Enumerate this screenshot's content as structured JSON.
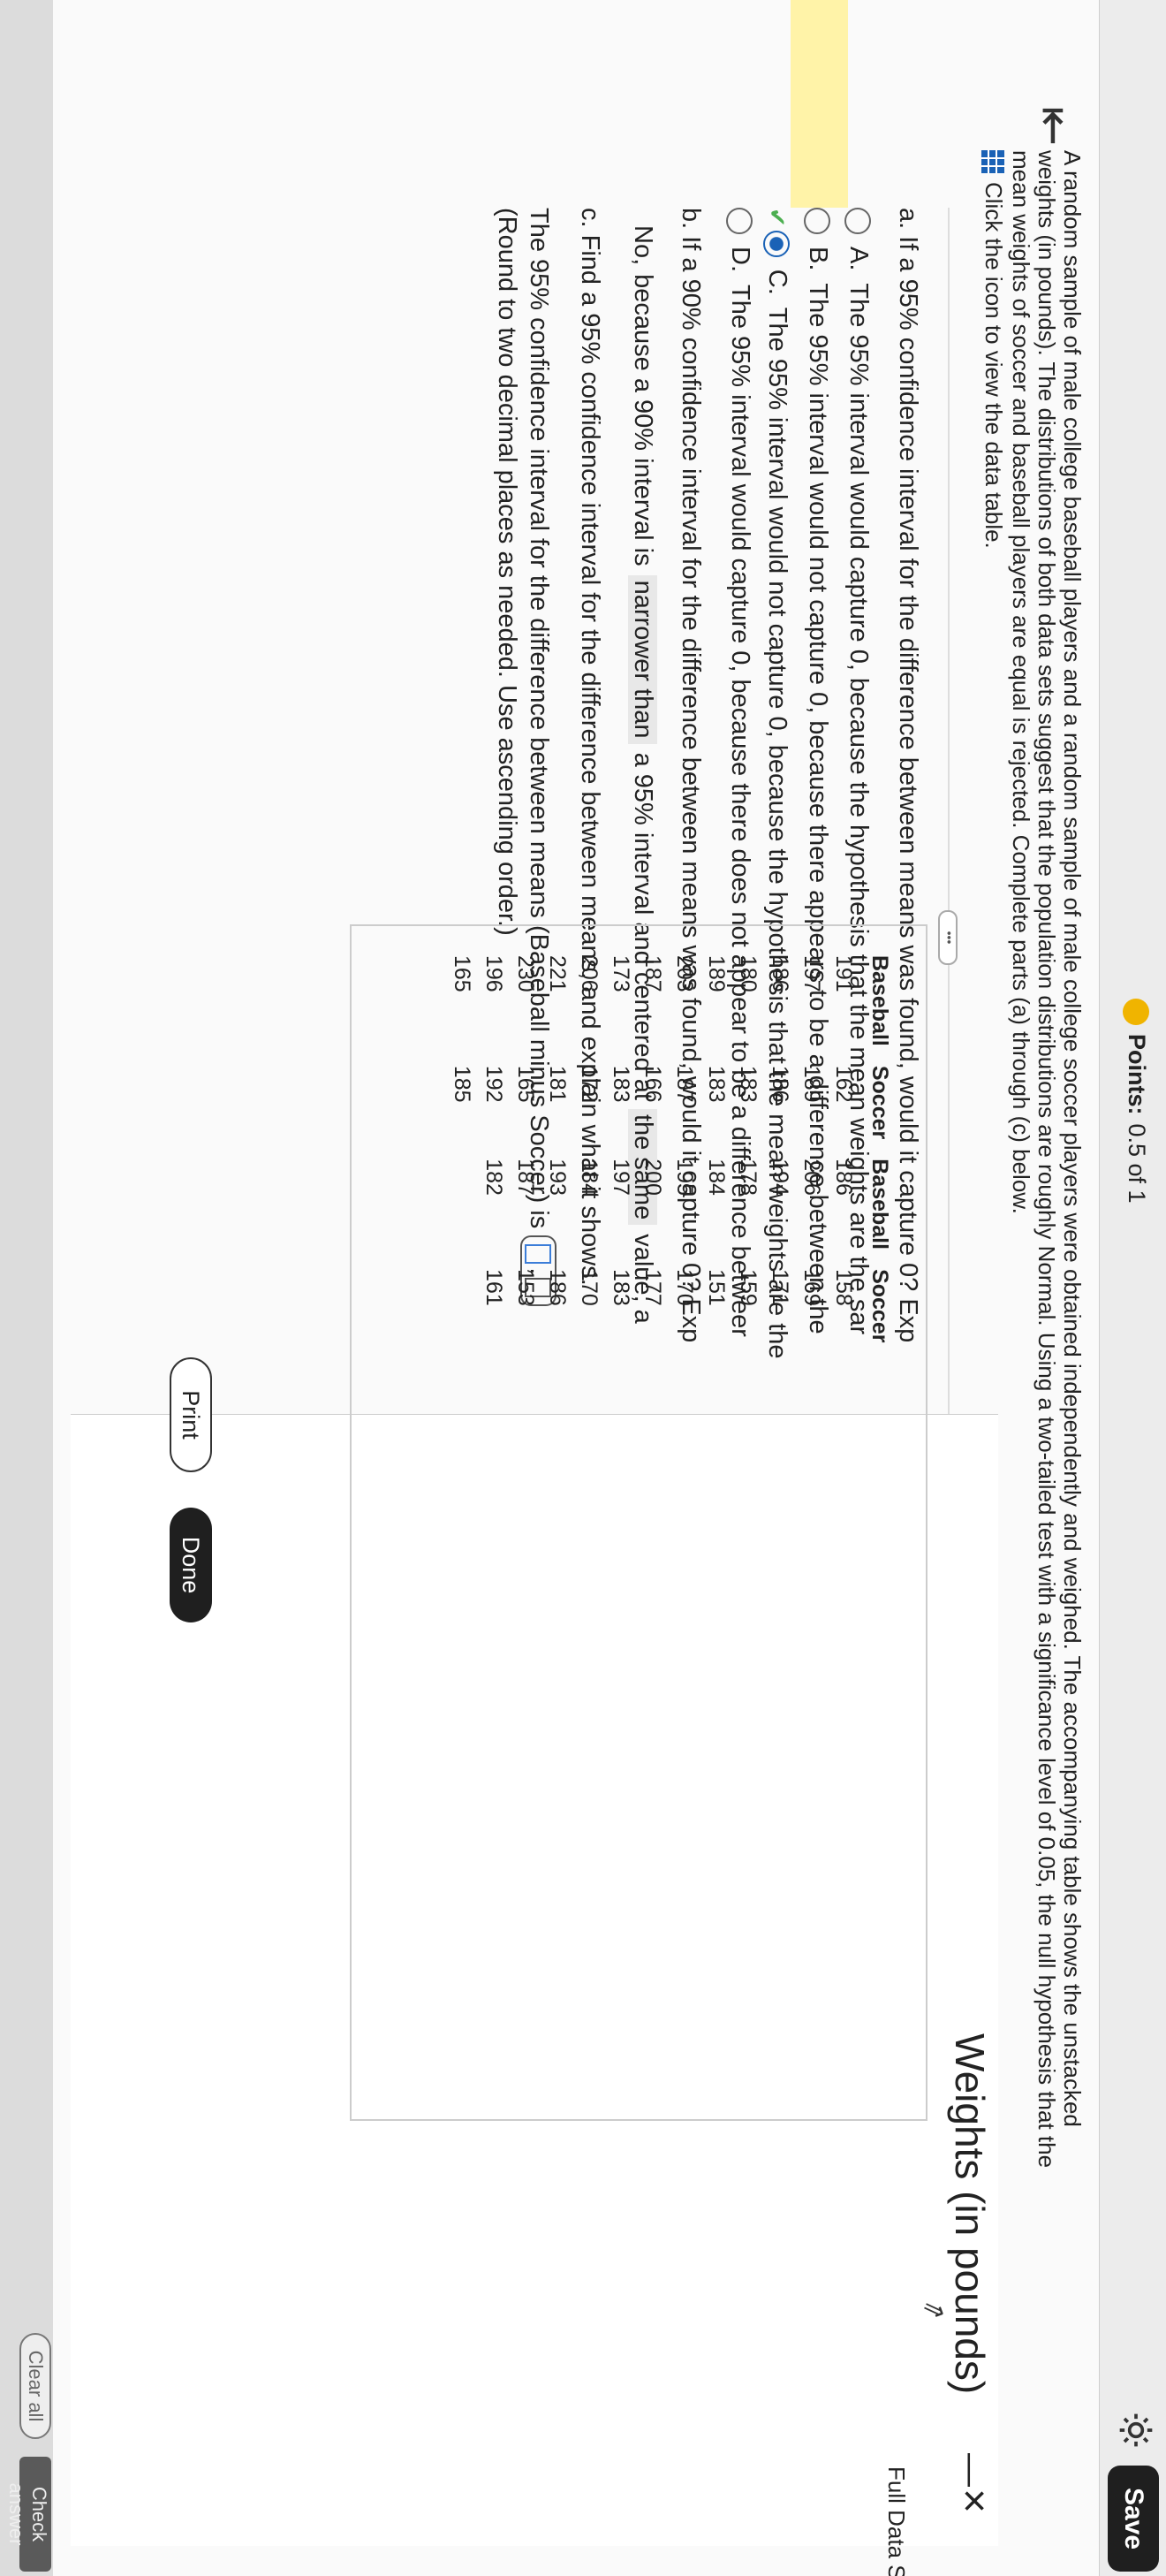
{
  "header": {
    "points_label": "Points:",
    "points_value": "0.5 of 1",
    "save_label": "Save"
  },
  "question": {
    "text_line1": "A random sample of male college baseball players and a random sample of male college soccer players were obtained independently and weighed. The accompanying table shows the unstacked",
    "text_line2": "weights (in pounds). The distributions of both data sets suggest that the population distributions are roughly Normal. Using a two-tailed test with a significance level of 0.05, the null hypothesis that the",
    "text_line3": "mean weights of soccer and baseball players are equal is rejected. Complete parts (a) through (c) below.",
    "data_link": "Click the icon to view the data table."
  },
  "part_a": {
    "question": "a. If a 95% confidence interval for the difference between means was found, would it capture 0? Exp",
    "options": [
      {
        "letter": "A.",
        "text": "The 95% interval would capture 0, because the hypothesis that the mean weights are the sar"
      },
      {
        "letter": "B.",
        "text": "The 95% interval would not capture 0, because there appears to be a difference between the"
      },
      {
        "letter": "C.",
        "text": "The 95% interval would not capture 0, because the hypothesis that the mean weights are the"
      },
      {
        "letter": "D.",
        "text": "The 95% interval would capture 0, because there does not appear to be a difference betweer"
      }
    ]
  },
  "part_b": {
    "question": "b. If a 90% confidence interval for the difference between means was found, would it capture 0? Exp",
    "answer_start": "No,",
    "answer_mid1": "because a 90% interval is",
    "blank1": "narrower than",
    "answer_mid2": "a 95% interval and centered at",
    "blank2": "the same",
    "answer_end": "value, a"
  },
  "part_c": {
    "question": "c. Find a 95% confidence interval for the difference between means, and explain what it shows.",
    "line": "The 95% confidence interval for the difference between means (Baseball minus Soccer) is",
    "separator": ",",
    "note": "(Round to two decimal places as needed. Use ascending order.)"
  },
  "dialog": {
    "title": "Weights (in pounds)",
    "full_data_label": "Full Data Set",
    "headers": [
      "Baseball",
      "Soccer",
      "Baseball",
      "Soccer"
    ],
    "rows": [
      [
        "191",
        "162",
        "186",
        "158"
      ],
      [
        "197",
        "189",
        "206",
        "169"
      ],
      [
        "186",
        "186",
        "194",
        "171"
      ],
      [
        "180",
        "183",
        "178",
        "159"
      ],
      [
        "189",
        "183",
        "184",
        "151"
      ],
      [
        "203",
        "187",
        "195",
        "170"
      ],
      [
        "187",
        "166",
        "200",
        "177"
      ],
      [
        "173",
        "183",
        "197",
        "183"
      ],
      [
        "206",
        "172",
        "184",
        "170"
      ],
      [
        "221",
        "181",
        "193",
        "186"
      ],
      [
        "230",
        "165",
        "187",
        "153"
      ],
      [
        "196",
        "192",
        "182",
        "161"
      ],
      [
        "165",
        "185",
        "",
        ""
      ]
    ],
    "print_label": "Print",
    "done_label": "Done"
  },
  "footer": {
    "clear_all_label": "Clear all",
    "check_answer_label": "Check answer"
  },
  "colors": {
    "save_bg": "#1f1f1f",
    "highlight": "#fff3a8",
    "check_green": "#4caf50",
    "link_blue": "#1a62b6"
  }
}
